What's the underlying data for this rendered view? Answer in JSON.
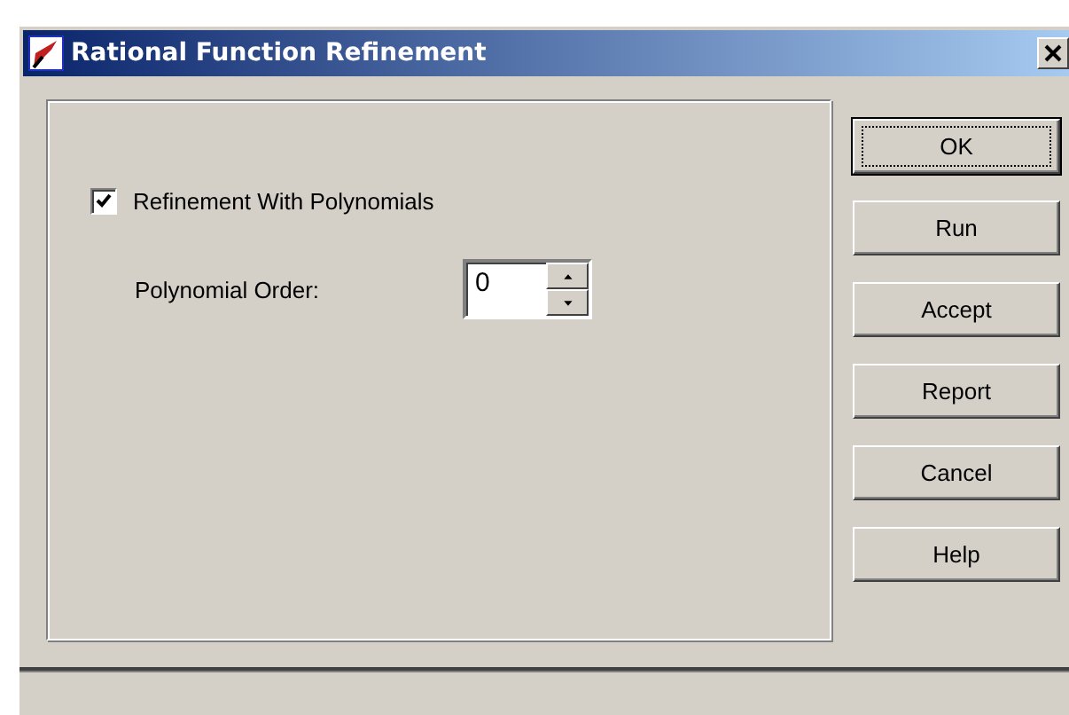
{
  "window": {
    "title": "Rational Function Refinement"
  },
  "options": {
    "checkbox": {
      "label": "Refinement With Polynomials",
      "checked": true
    },
    "spinner": {
      "label": "Polynomial Order:",
      "value": "0"
    }
  },
  "buttons": [
    {
      "label": "OK",
      "focused": true
    },
    {
      "label": "Run",
      "focused": false
    },
    {
      "label": "Accept",
      "focused": false
    },
    {
      "label": "Report",
      "focused": false
    },
    {
      "label": "Cancel",
      "focused": false
    },
    {
      "label": "Help",
      "focused": false
    }
  ]
}
